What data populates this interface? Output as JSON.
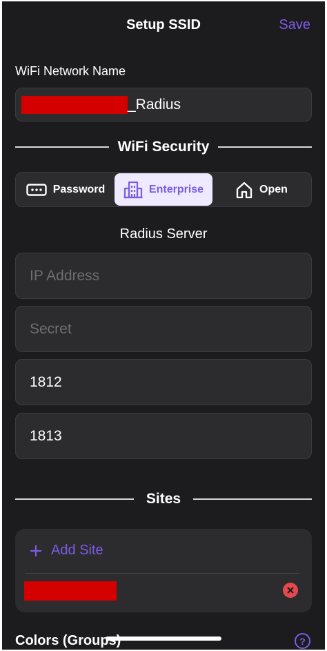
{
  "header": {
    "title": "Setup SSID",
    "save_label": "Save"
  },
  "network": {
    "label": "WiFi Network Name",
    "value_suffix": "_Radius"
  },
  "security": {
    "heading": "WiFi Security",
    "options": [
      {
        "label": "Password",
        "icon": "password-dots-icon",
        "selected": false
      },
      {
        "label": "Enterprise",
        "icon": "building-icon",
        "selected": true
      },
      {
        "label": "Open",
        "icon": "home-icon",
        "selected": false
      }
    ]
  },
  "radius": {
    "heading": "Radius Server",
    "ip_placeholder": "IP Address",
    "secret_placeholder": "Secret",
    "auth_port": "1812",
    "acct_port": "1813"
  },
  "sites": {
    "heading": "Sites",
    "add_label": "Add Site"
  },
  "colors": {
    "label": "Colors (Groups)"
  },
  "theme": {
    "accent": "#7b5ce6",
    "background": "#1c1c1e",
    "field": "#2c2c2e",
    "remove": "#e5484d"
  }
}
